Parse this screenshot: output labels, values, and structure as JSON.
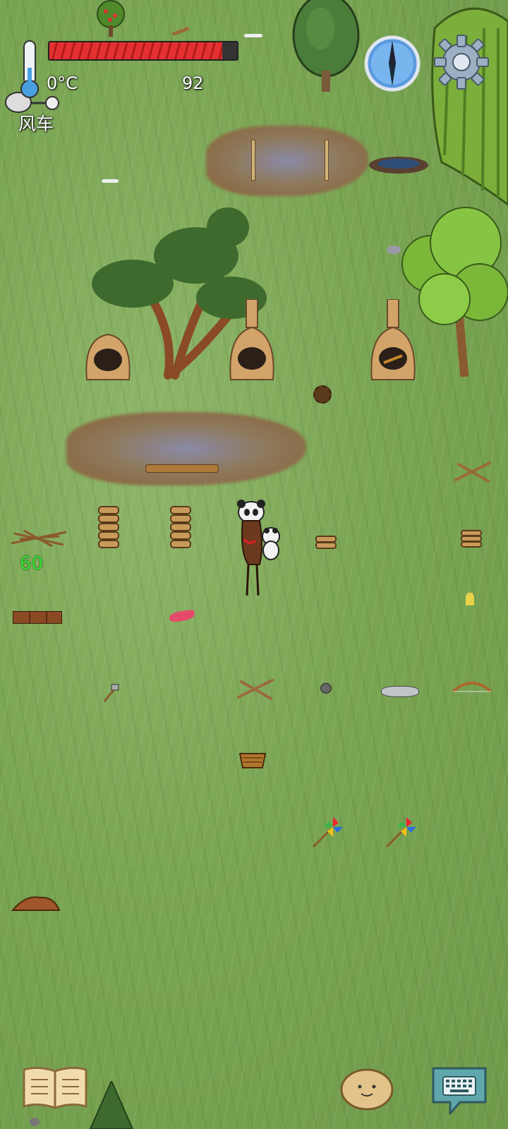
{
  "hud": {
    "temperature": "0°C",
    "health_value": "92",
    "health_fraction": 0.92,
    "biome_label": "风车",
    "item_counter": "60"
  },
  "icons": {
    "compass": "compass-icon",
    "settings": "gear-icon",
    "journal": "open-book-icon",
    "emote": "potato-face-icon",
    "chat": "keyboard-speech-bubble-icon"
  },
  "colors": {
    "grass": "#7aa553",
    "health_red": "#e43030",
    "counter_green": "#33dd33",
    "compass_blue": "#4a8fd8"
  }
}
